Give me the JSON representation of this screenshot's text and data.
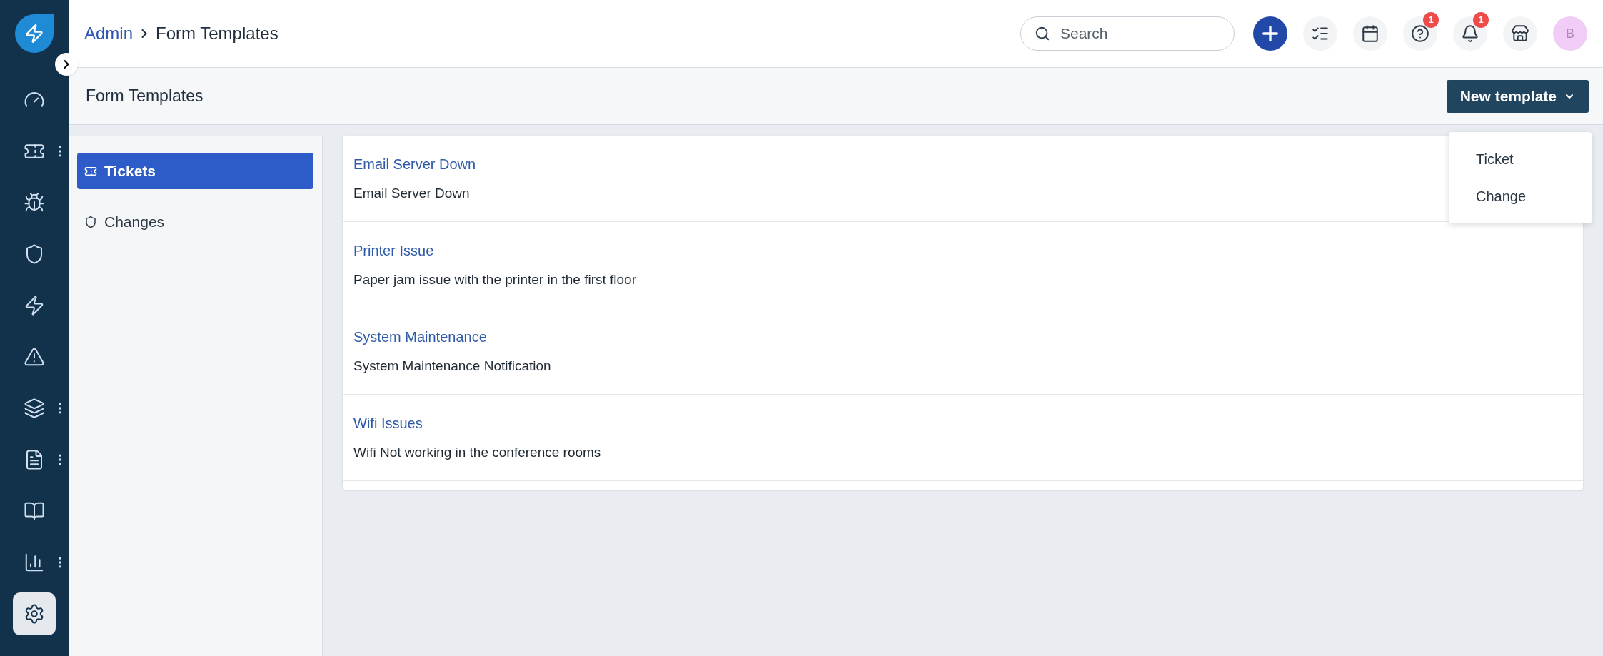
{
  "sidebar": {
    "items": [
      {
        "selected": false,
        "has_menu": false
      },
      {
        "selected": false,
        "has_menu": true
      },
      {
        "selected": false,
        "has_menu": false
      },
      {
        "selected": false,
        "has_menu": false
      },
      {
        "selected": false,
        "has_menu": false
      },
      {
        "selected": false,
        "has_menu": false
      },
      {
        "selected": false,
        "has_menu": true
      },
      {
        "selected": false,
        "has_menu": true
      },
      {
        "selected": false,
        "has_menu": false
      },
      {
        "selected": false,
        "has_menu": true
      },
      {
        "selected": true,
        "has_menu": false
      }
    ]
  },
  "breadcrumb": [
    "Admin",
    "Form Templates"
  ],
  "search": {
    "placeholder": "Search"
  },
  "toolbar": [
    {
      "kind": "add"
    },
    {
      "kind": "tasks"
    },
    {
      "kind": "calendar"
    },
    {
      "kind": "help",
      "badge": "1"
    },
    {
      "kind": "notifications",
      "badge": "1"
    },
    {
      "kind": "store"
    }
  ],
  "avatar": "B",
  "page_title": "Form Templates",
  "new_template_button": "New template",
  "new_template_menu": [
    "Ticket",
    "Change"
  ],
  "categories": [
    {
      "label": "Tickets",
      "selected": true
    },
    {
      "label": "Changes",
      "selected": false
    }
  ],
  "templates": [
    {
      "title": "Email Server Down",
      "description": "Email Server Down"
    },
    {
      "title": "Printer Issue",
      "description": "Paper jam issue with the printer in the first floor"
    },
    {
      "title": "System Maintenance",
      "description": "System Maintenance Notification"
    },
    {
      "title": "Wifi Issues",
      "description": "Wifi Not working in the conference rooms"
    }
  ]
}
